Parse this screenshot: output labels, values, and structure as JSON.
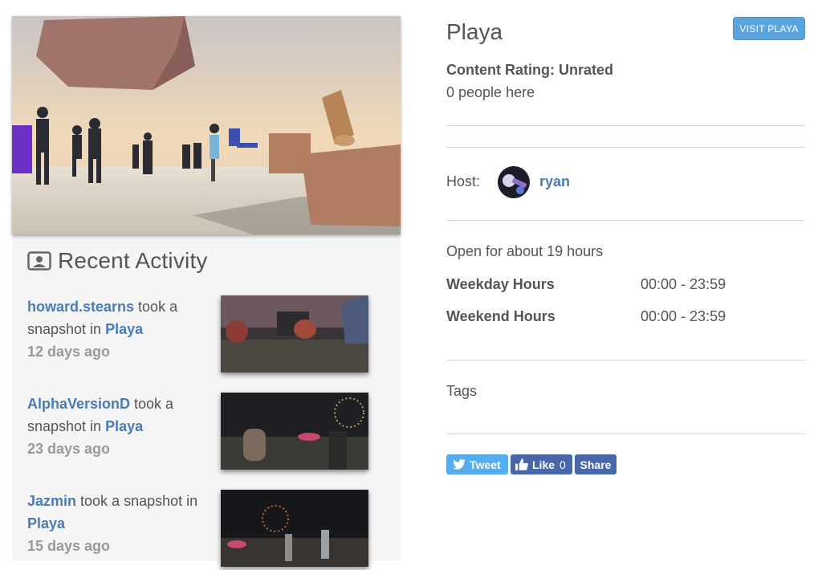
{
  "place": {
    "title": "Playa",
    "visit_button": "VISIT PLAYA",
    "content_rating": "Content Rating: Unrated",
    "people_here": "0 people here",
    "host_label": "Host:",
    "host_name": "ryan",
    "open_for": "Open for about 19 hours",
    "hours": [
      {
        "label": "Weekday Hours",
        "value": "00:00 - 23:59"
      },
      {
        "label": "Weekend Hours",
        "value": "00:00 - 23:59"
      }
    ],
    "tags_label": "Tags"
  },
  "social": {
    "tweet": "Tweet",
    "like": "Like",
    "like_count": "0",
    "share": "Share"
  },
  "recent_activity": {
    "title": "Recent Activity",
    "items": [
      {
        "user": "howard.stearns",
        "action_pre": " took a snapshot in ",
        "place": "Playa",
        "time": "12 days ago"
      },
      {
        "user": "AlphaVersionD",
        "action_pre": " took a snapshot in ",
        "place": "Playa",
        "time": "23 days ago"
      },
      {
        "user": "Jazmin",
        "action_pre": " took a snapshot in ",
        "place": "Playa",
        "time": "15 days ago"
      }
    ]
  },
  "colors": {
    "link": "#4a7bb7",
    "visit_button": "#5aa5dd",
    "tweet": "#55acee",
    "facebook": "#4867aa"
  },
  "icons": {
    "recent_activity": "person-card-icon",
    "tweet": "twitter-bird-icon",
    "like": "thumbs-up-icon"
  }
}
